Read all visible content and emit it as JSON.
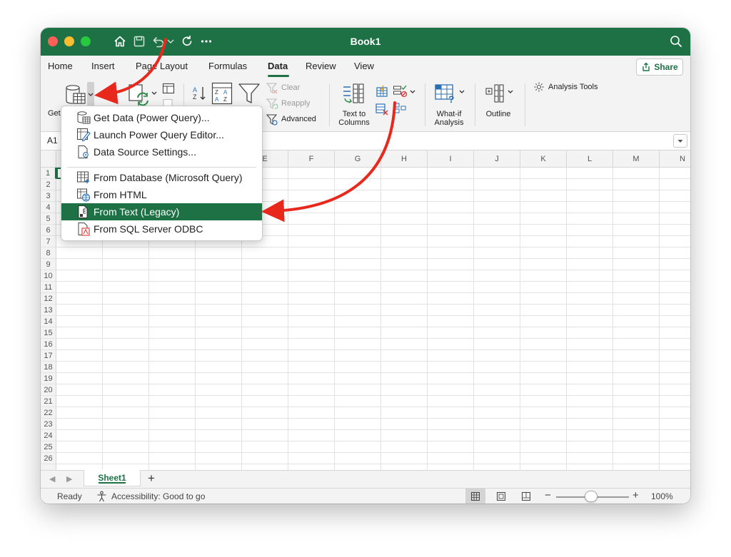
{
  "window": {
    "title": "Book1"
  },
  "ribbon_tabs": [
    {
      "label": "Home"
    },
    {
      "label": "Insert"
    },
    {
      "label": "Page Layout"
    },
    {
      "label": "Formulas"
    },
    {
      "label": "Data",
      "active": true
    },
    {
      "label": "Review"
    },
    {
      "label": "View"
    }
  ],
  "share_label": "Share",
  "ribbon": {
    "get_data_label": "Get",
    "clear_label": "Clear",
    "reapply_label": "Reapply",
    "advanced_label": "Advanced",
    "text_to_columns_label": "Text to\nColumns",
    "what_if_label": "What-if\nAnalysis",
    "outline_label": "Outline",
    "analysis_tools_label": "Analysis Tools"
  },
  "formula_bar": {
    "name_box": "A1"
  },
  "columns": [
    "E",
    "F",
    "G",
    "H",
    "I",
    "J",
    "K",
    "L",
    "M",
    "N"
  ],
  "rows": [
    "1",
    "2",
    "3",
    "4",
    "5",
    "6",
    "7",
    "8",
    "9",
    "10",
    "11",
    "12",
    "13",
    "14",
    "15",
    "16",
    "17",
    "18",
    "19",
    "20",
    "21",
    "22",
    "23",
    "24",
    "25",
    "26"
  ],
  "dropdown_menu": {
    "items": [
      {
        "label": "Get Data (Power Query)...",
        "icon": "database-icon"
      },
      {
        "label": "Launch Power Query Editor...",
        "icon": "edit-query-icon"
      },
      {
        "label": "Data Source Settings...",
        "icon": "settings-doc-icon"
      },
      {
        "label": "From Database (Microsoft Query)",
        "icon": "table-database-icon"
      },
      {
        "label": "From HTML",
        "icon": "globe-table-icon"
      },
      {
        "label": "From Text (Legacy)",
        "icon": "text-file-icon",
        "highlighted": true
      },
      {
        "label": "From SQL Server ODBC",
        "icon": "sql-file-icon"
      }
    ]
  },
  "sheet_tabs": {
    "active": "Sheet1",
    "add_label": "+"
  },
  "status_bar": {
    "ready": "Ready",
    "accessibility": "Accessibility: Good to go",
    "zoom_minus": "−",
    "zoom_plus": "+",
    "zoom": "100%",
    "zoom_level_percent": 100
  },
  "colors": {
    "brand_green": "#1e7145",
    "arrow_red": "#e8281c",
    "highlight": "#1e7145"
  }
}
